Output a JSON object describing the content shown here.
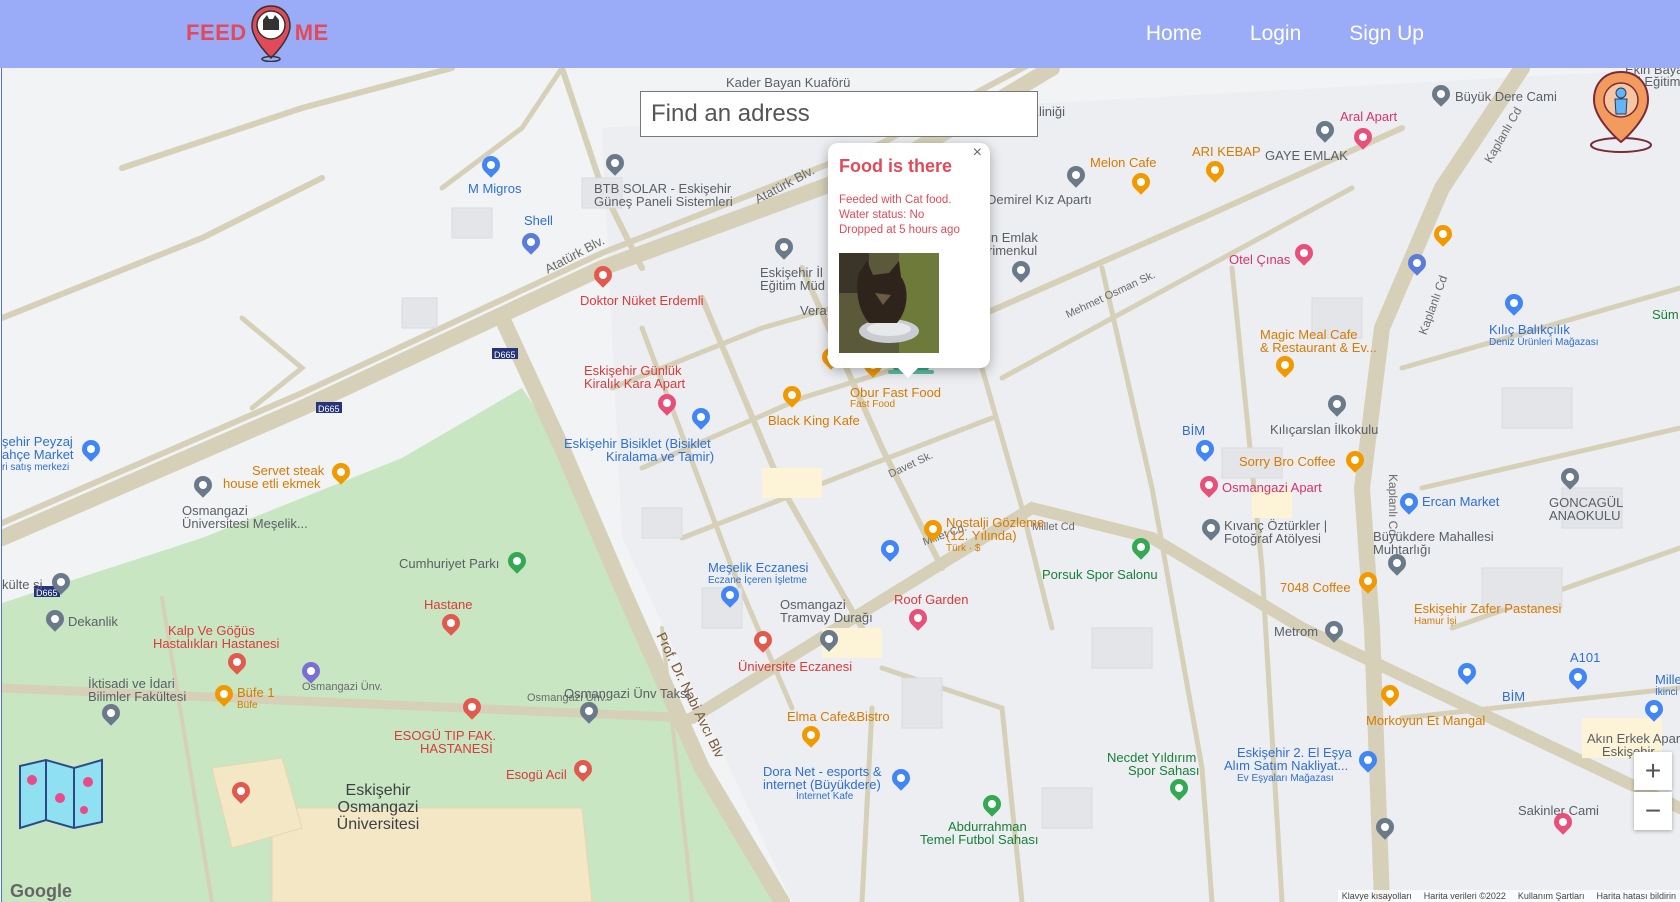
{
  "nav": {
    "logo_left": "FEED",
    "logo_right": "ME",
    "links": [
      "Home",
      "Login",
      "Sign Up"
    ]
  },
  "search": {
    "placeholder": "Find an adress"
  },
  "popup": {
    "title": "Food is there",
    "close": "×",
    "lines": [
      "Feeded with Cat food.",
      "Water status: No",
      "Dropped at 5 hours ago"
    ]
  },
  "map_controls": {
    "zoom_in": "+",
    "zoom_out": "−"
  },
  "attribution": {
    "google": "Google",
    "items": [
      "Klavye kısayolları",
      "Harita verileri ©2022",
      "Kullanım Şartları",
      "Harita hatası bildirin"
    ]
  },
  "places": {
    "kader": "Kader Bayan Kuaförü",
    "mmigros": "M Migros",
    "shell": "Shell",
    "btb1": "BTB SOLAR - Eskişehir",
    "btb2": "Güneş Paneli Sistemleri",
    "klinik": "iner Kliniği",
    "demirel": "Demirel Kız Apartı",
    "emlak1": "in Emlak",
    "emlak2": "rimenkul",
    "melon": "Melon Cafe",
    "arikebap": "ARI KEBAP",
    "gaye": "GAYE EMLAK",
    "aral": "Aral Apart",
    "buyukdere": "Büyük Dere Cami",
    "ekinbayan1": "Ekin Bayan",
    "ekinbayan2": "Özel Eğitim",
    "nuket": "Doktor Nüket Erdemli",
    "egitim1": "Eskişehir İl",
    "egitim2": "Eğitim Müd",
    "vera": "Vera",
    "otelcinas": "Otel Çınas",
    "magic1": "Magic Meal Cafe",
    "magic2": "& Restaurant & Ev...",
    "kilic1": "Kılıç Balıkçılık",
    "kilic2": "Deniz Ürünleri Mağazası",
    "sumer": "Süm",
    "gunluk1": "Eskişehir Günlük",
    "gunluk2": "Kiralık Kara Apart",
    "obur": "Obur Fast Food",
    "obur_sub": "Fast Food",
    "blackking": "Black King Kafe",
    "bisiklet1": "Eskişehir Bisiklet (Bisiklet",
    "bisiklet2": "Kiralama ve Tamir)",
    "peyzaj1": "şehir Peyzaj",
    "peyzaj2": "ahçe Market",
    "peyzaj3": "ri satış merkezi",
    "servet1": "Servet steak",
    "servet2": "house etli ekmek",
    "mesclik1": "Osmangazi",
    "mesclik2": "Üniversitesi Meşelik...",
    "kilicarslan": "Kılıçarslan İlkokulu",
    "bim1": "BİM",
    "sorry": "Sorry Bro Coffee",
    "osmangaziapart": "Osmangazi Apart",
    "ercan": "Ercan Market",
    "goncagul1": "GONCAGÜL",
    "goncagul2": "ANAOKULU",
    "kivanc1": "Kıvanç Öztürkler |",
    "kivanc2": "Fotoğraf Atölyesi",
    "buyukdeream1": "Büyükdere Mahallesi",
    "buyukdeream2": "Muhtarlığı",
    "nostalji1": "Nostalji Gözleme",
    "nostalji2": "(12. Yılında)",
    "nostalji3": "Türk · $",
    "cumhuriyet": "Cumhuriyet Parkı",
    "porsuk": "Porsuk Spor Salonu",
    "coffee7048": "7048 Coffee",
    "zafer1": "Eskişehir Zafer Pastanesi",
    "zafer2": "Hamur İşi",
    "mescelik_ecz1": "Meşelik Eczanesi",
    "mescelik_ecz2": "Eczane İçeren İşletme",
    "dekanlik": "Dekanlik",
    "kulte": "külte si",
    "hastane": "Hastane",
    "kalp1": "Kalp Ve Göğüs",
    "kalp2": "Hastalıkları Hastanesi",
    "tramvay1": "Osmangazi",
    "tramvay2": "Tramvay Durağı",
    "roof": "Roof Garden",
    "metrom": "Metrom",
    "a101": "A101",
    "millet1": "Millet Sp",
    "millet2": "İkinci El M",
    "universite_ecz": "Üniversite Eczanesi",
    "iktisat1": "İktisadi ve İdari",
    "iktisat2": "Bilimler Fakültesi",
    "bufe1": "Büfe 1",
    "bufe_sub": "Büfe",
    "taksi": "Osmangazi Ünv Taksi",
    "bim2": "BİM",
    "morkoyun": "Morkoyun Et Mangal",
    "akin1": "Akın Erkek Apart",
    "akin2": "Eskişehir",
    "elma": "Elma Cafe&Bistro",
    "esogu1": "ESOGÜ TIP FAK.",
    "esogu2": "HASTANESİ",
    "esoguacil": "Esogü Acil",
    "univ1": "Eskişehir",
    "univ2": "Osmangazi",
    "univ3": "Üniversitesi",
    "dora1": "Dora Net - esports &",
    "dora2": "internet (Büyükdere)",
    "dora3": "İnternet Kafe",
    "necdet1": "Necdet Yıldırım",
    "necdet2": "Spor Sahası",
    "ikinci1": "Eskişehir 2. El Eşya",
    "ikinci2": "Alım Satım Nakliyat...",
    "ikinci3": "Ev Eşyaları Mağazası",
    "sakinler": "Sakinler Cami",
    "abdurrahman1": "Abdurrahman",
    "abdurrahman2": "Temel Futbol Sahası"
  },
  "streets": {
    "ataturk1": "Atatürk Blv.",
    "ataturk2": "Atatürk Blv.",
    "d665a": "D665",
    "d665b": "D665",
    "d665c": "D665",
    "nabi": "Prof. Dr. Nabi Avcı Blv",
    "kaplanli1": "Kaplanlı Cd",
    "kaplanli2": "Kaplanlı Cd",
    "kaplanli3": "Kaplanlı Cd",
    "milletcd": "Millet Cd.",
    "milletcd2": "Millet Cd",
    "osmangaziunv1": "Osmangazi Ünv.",
    "osmangaziunv2": "Osmangazi Ünv.",
    "davet": "Davet Sk.",
    "mehmet": "Mehmet Osman Sk."
  },
  "colors": {
    "nav_bg": "#9aabf7",
    "brand_red": "#e24a5a",
    "park_green": "#c8e6c1",
    "road": "#d6d0b8"
  }
}
